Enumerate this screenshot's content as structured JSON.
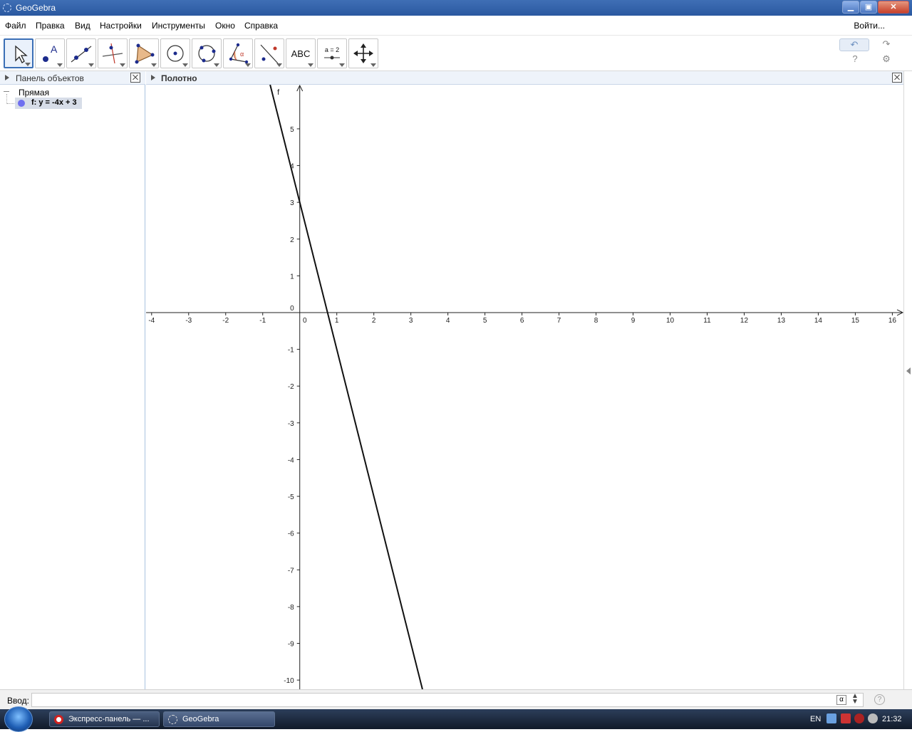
{
  "window": {
    "title": "GeoGebra",
    "min_glyph": "▁",
    "max_glyph": "▣",
    "close_glyph": "✕"
  },
  "menu": {
    "items": [
      "Файл",
      "Правка",
      "Вид",
      "Настройки",
      "Инструменты",
      "Окно",
      "Справка"
    ],
    "login": "Войти..."
  },
  "toolbar": {
    "tools": [
      {
        "icon": "move-arrow-icon",
        "active": true
      },
      {
        "icon": "point-icon",
        "active": false
      },
      {
        "icon": "line-through-points-icon",
        "active": false
      },
      {
        "icon": "perpendicular-line-icon",
        "active": false
      },
      {
        "icon": "polygon-icon",
        "active": false
      },
      {
        "icon": "circle-center-point-icon",
        "active": false
      },
      {
        "icon": "circle-three-points-icon",
        "active": false
      },
      {
        "icon": "angle-icon",
        "active": false
      },
      {
        "icon": "reflect-icon",
        "active": false
      },
      {
        "icon": "text-icon",
        "active": false,
        "label": "ABC"
      },
      {
        "icon": "slider-icon",
        "active": false,
        "label": "a = 2"
      },
      {
        "icon": "move-graphics-icon",
        "active": false
      }
    ],
    "undo": "↶",
    "redo": "↷",
    "help": "?",
    "settings": "⚙"
  },
  "algebra": {
    "title": "Панель объектов",
    "category": "Прямая",
    "objects": [
      {
        "label": "f: y = -4x + 3",
        "color": "#6f6ff0"
      }
    ]
  },
  "graphics": {
    "title": "Полотно"
  },
  "chart_data": {
    "type": "line",
    "title": "",
    "xlabel": "",
    "ylabel": "",
    "xlim": [
      -4.15,
      16.3
    ],
    "ylim": [
      -10.25,
      6.2
    ],
    "x_ticks": [
      -4,
      -3,
      -2,
      -1,
      0,
      1,
      2,
      3,
      4,
      5,
      6,
      7,
      8,
      9,
      10,
      11,
      12,
      13,
      14,
      15,
      16
    ],
    "y_ticks": [
      5,
      4,
      3,
      2,
      1,
      0,
      -1,
      -2,
      -3,
      -4,
      -5,
      -6,
      -7,
      -8,
      -9,
      -10
    ],
    "grid": false,
    "series": [
      {
        "name": "f",
        "slope": -4,
        "intercept": 3,
        "color": "#111111"
      }
    ]
  },
  "input": {
    "label": "Ввод:",
    "value": "",
    "placeholder": "",
    "alpha": "α",
    "help": "?"
  },
  "taskbar": {
    "tasks": [
      {
        "label": "Экспресс-панель — ..."
      },
      {
        "label": "GeoGebra"
      }
    ],
    "lang": "EN",
    "clock": "21:32"
  }
}
